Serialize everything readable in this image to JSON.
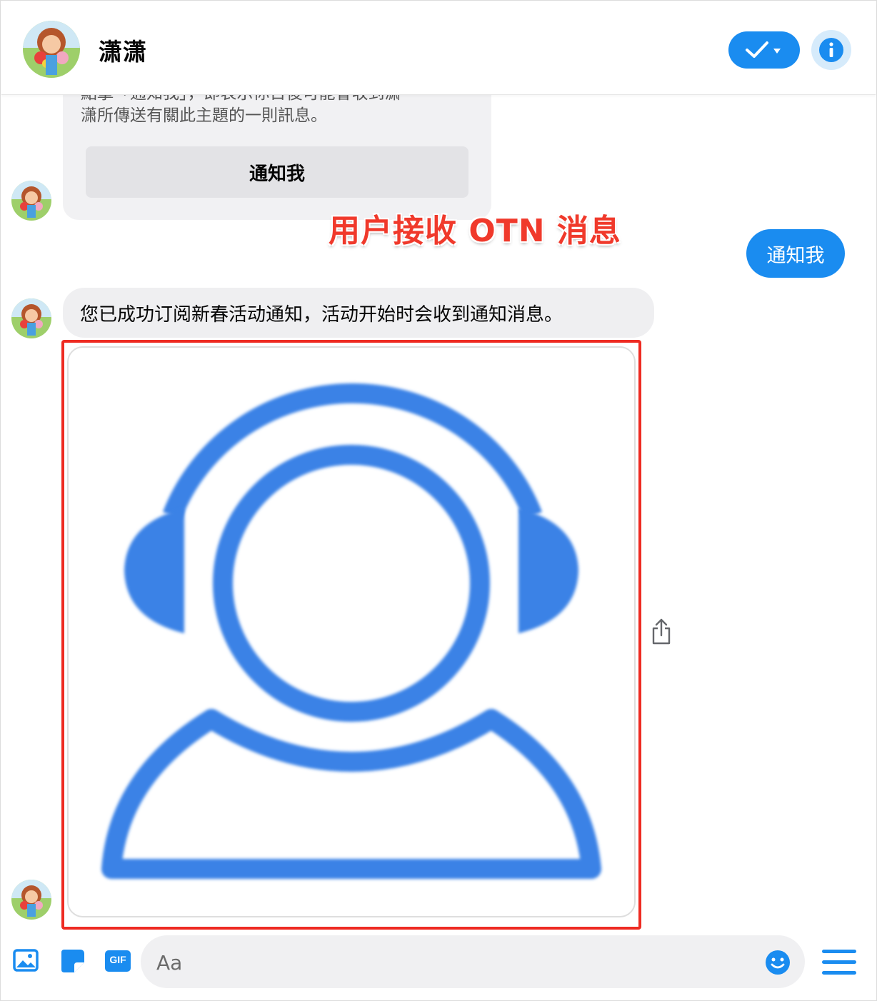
{
  "header": {
    "contact_name": "潇潇",
    "check_icon": "checkmark-dropdown-icon",
    "info_icon": "info-icon"
  },
  "template_card": {
    "text_line1": "點擊「通知我」，即表示你日後可能會收到潇",
    "text_line2": "潇所傳送有關此主題的一則訊息。",
    "button_label": "通知我"
  },
  "annotation": "用户接收 OTN 消息",
  "outgoing_message": "通知我",
  "incoming_message": "您已成功订阅新春活动通知，活动开始时会收到通知消息。",
  "image_message": {
    "icon": "headset-agent-icon",
    "share_icon": "share-icon"
  },
  "composer": {
    "placeholder": "Aa",
    "icons": [
      "photo-icon",
      "sticker-icon",
      "gif-icon",
      "emoji-icon",
      "menu-icon"
    ],
    "gif_label": "GIF"
  },
  "colors": {
    "accent_blue": "#1a8cf0",
    "highlight_red": "#ee2b22",
    "icon_blue": "#3b82e6"
  }
}
